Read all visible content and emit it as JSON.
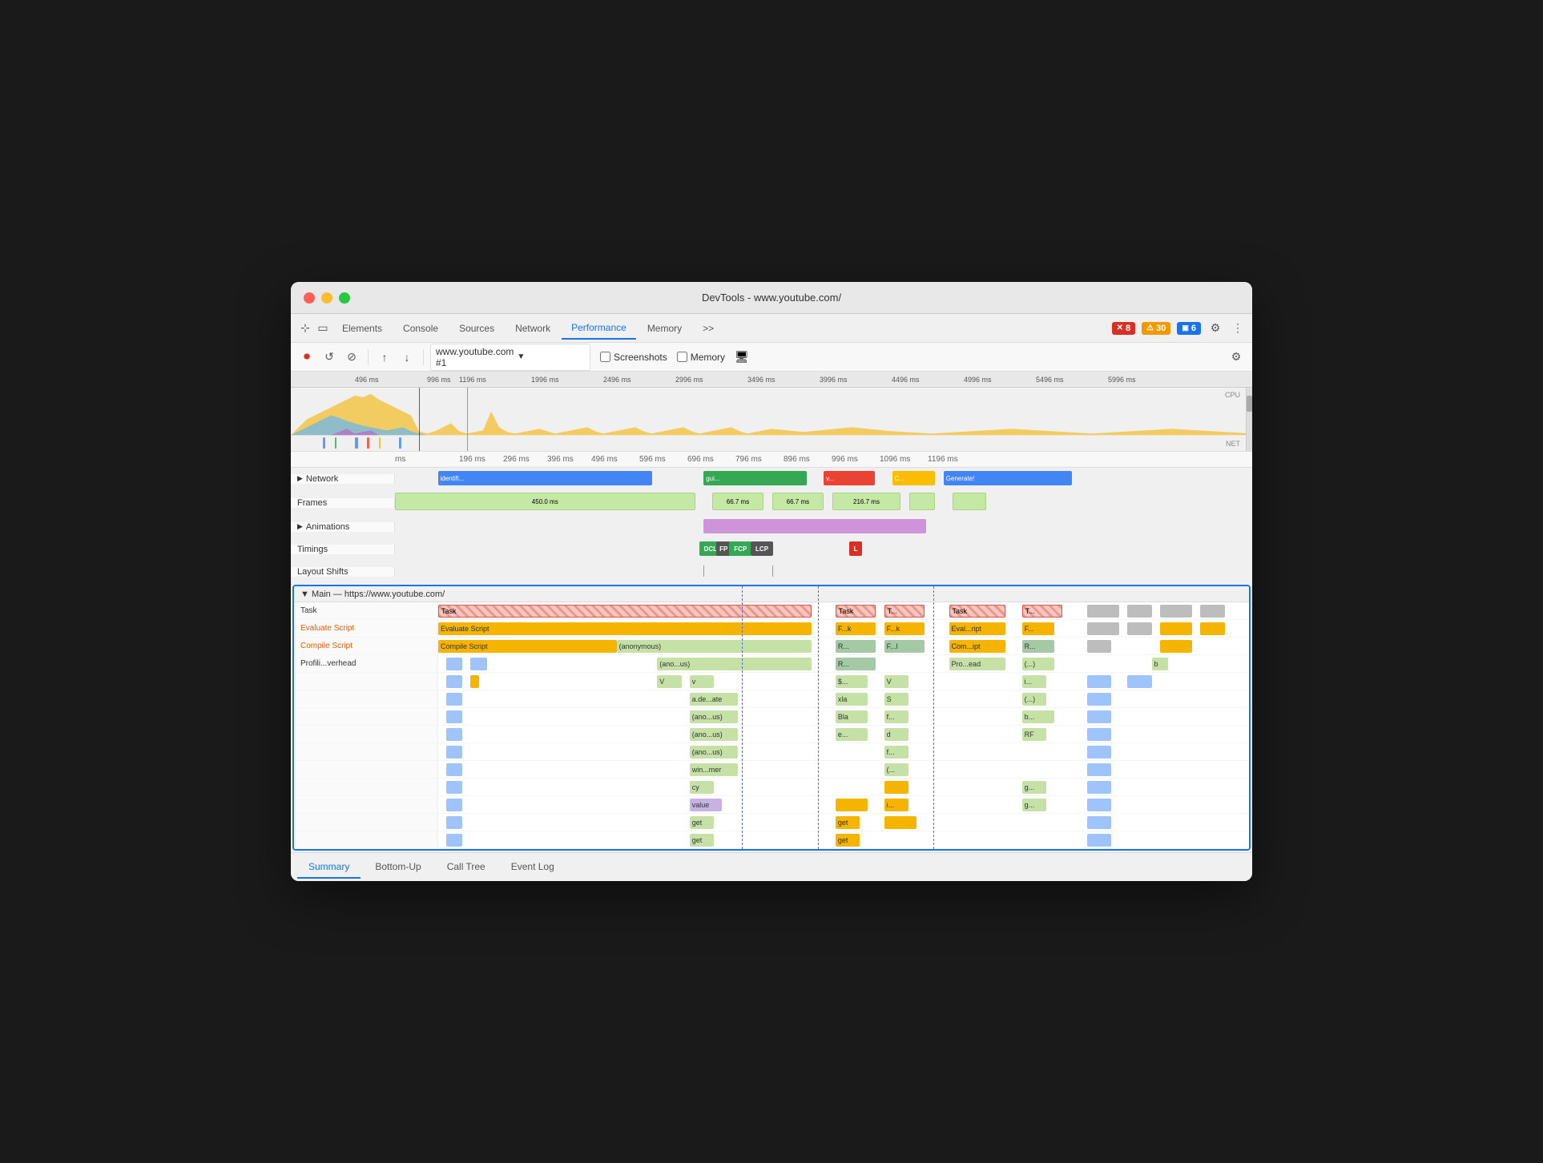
{
  "window": {
    "title": "DevTools - www.youtube.com/"
  },
  "tabs": [
    {
      "label": "Elements",
      "active": false
    },
    {
      "label": "Console",
      "active": false
    },
    {
      "label": "Sources",
      "active": false
    },
    {
      "label": "Network",
      "active": false
    },
    {
      "label": "Performance",
      "active": true
    },
    {
      "label": "Memory",
      "active": false
    }
  ],
  "more_tabs": ">>",
  "errors": {
    "red_count": "8",
    "yellow_count": "30",
    "blue_count": "6"
  },
  "toolbar": {
    "record_label": "Record",
    "reload_label": "Reload",
    "clear_label": "Clear",
    "upload_label": "Upload",
    "download_label": "Download",
    "url_value": "www.youtube.com #1",
    "screenshots_label": "Screenshots",
    "memory_label": "Memory"
  },
  "timeline": {
    "markers": [
      "496 ms",
      "996 ms",
      "1196 ms",
      "1996 ms",
      "2496 ms",
      "2996 ms",
      "3496 ms",
      "3996 ms",
      "4496 ms",
      "4996 ms",
      "5496 ms",
      "5996 ms"
    ],
    "cpu_label": "CPU",
    "net_label": "NET"
  },
  "tracks": {
    "time_markers": [
      "ms",
      "196 ms",
      "296 ms",
      "396 ms",
      "496 ms",
      "596 ms",
      "696 ms",
      "796 ms",
      "896 ms",
      "996 ms",
      "1096 ms",
      "1196 ms"
    ],
    "network_label": "Network",
    "frames_label": "Frames",
    "animations_label": "Animations",
    "timings_label": "Timings",
    "layout_shifts_label": "Layout Shifts"
  },
  "main": {
    "header": "▼  Main — https://www.youtube.com/",
    "rows": [
      {
        "label": "Task",
        "blocks": [
          {
            "text": "Task",
            "color": "#e8998d",
            "left": "0%",
            "width": "48%"
          },
          {
            "text": "Task",
            "color": "#e8998d",
            "left": "51%",
            "width": "5%"
          },
          {
            "text": "T...",
            "color": "#e8998d",
            "left": "57%",
            "width": "7%"
          },
          {
            "text": "Task",
            "color": "#e8998d",
            "left": "66%",
            "width": "8%"
          },
          {
            "text": "T...",
            "color": "#e8998d",
            "left": "77%",
            "width": "5%"
          }
        ]
      },
      {
        "label": "Evaluate Script",
        "blocks": [
          {
            "text": "Evaluate Script",
            "color": "#f4b400",
            "left": "0%",
            "width": "47%"
          },
          {
            "text": "F...k",
            "color": "#f4b400",
            "left": "51%",
            "width": "5%"
          },
          {
            "text": "F...k",
            "color": "#f4b400",
            "left": "57%",
            "width": "7%"
          },
          {
            "text": "Eval...ript",
            "color": "#f4b400",
            "left": "66%",
            "width": "8%"
          },
          {
            "text": "F...",
            "color": "#f4b400",
            "left": "77%",
            "width": "5%"
          }
        ]
      },
      {
        "label": "Compile Script",
        "blocks": [
          {
            "text": "Compile Script",
            "color": "#f4b400",
            "left": "0%",
            "width": "25%"
          },
          {
            "text": "(anonymous)",
            "color": "#c5e1a5",
            "left": "25%",
            "width": "22%"
          },
          {
            "text": "R...",
            "color": "#a8d5a2",
            "left": "51%",
            "width": "5%"
          },
          {
            "text": "F...l",
            "color": "#a8d5a2",
            "left": "57%",
            "width": "7%"
          },
          {
            "text": "Com...ipt",
            "color": "#f4b400",
            "left": "66%",
            "width": "8%"
          },
          {
            "text": "R...",
            "color": "#a8d5a2",
            "left": "77%",
            "width": "5%"
          }
        ]
      },
      {
        "label": "Profili...verhead",
        "blocks": [
          {
            "text": "(ano...us)",
            "color": "#c5e1a5",
            "left": "36%",
            "width": "11%"
          },
          {
            "text": "R...",
            "color": "#a8d5a2",
            "left": "51%",
            "width": "5%"
          },
          {
            "text": "Pro...ead",
            "color": "#c5e1a5",
            "left": "66%",
            "width": "8%"
          },
          {
            "text": "(...)",
            "color": "#c5e1a5",
            "left": "77%",
            "width": "5%"
          },
          {
            "text": "b",
            "color": "#c5e1a5",
            "left": "89%",
            "width": "3%"
          }
        ]
      },
      {
        "label": "",
        "blocks": [
          {
            "text": "V",
            "color": "#c5e1a5",
            "left": "36%",
            "width": "3%"
          },
          {
            "text": "v",
            "color": "#c5e1a5",
            "left": "40%",
            "width": "4%"
          },
          {
            "text": "$...",
            "color": "#c5e1a5",
            "left": "51%",
            "width": "5%"
          },
          {
            "text": "V",
            "color": "#c5e1a5",
            "left": "57%",
            "width": "4%"
          },
          {
            "text": "i...",
            "color": "#c5e1a5",
            "left": "77%",
            "width": "5%"
          }
        ]
      },
      {
        "label": "",
        "blocks": [
          {
            "text": "a.de...ate",
            "color": "#c5e1a5",
            "left": "40%",
            "width": "7%"
          },
          {
            "text": "xla",
            "color": "#c5e1a5",
            "left": "51%",
            "width": "5%"
          },
          {
            "text": "S",
            "color": "#c5e1a5",
            "left": "57%",
            "width": "4%"
          },
          {
            "text": "(...)",
            "color": "#c5e1a5",
            "left": "77%",
            "width": "5%"
          }
        ]
      },
      {
        "label": "",
        "blocks": [
          {
            "text": "(ano...us)",
            "color": "#c5e1a5",
            "left": "40%",
            "width": "7%"
          },
          {
            "text": "Bla",
            "color": "#c5e1a5",
            "left": "51%",
            "width": "5%"
          },
          {
            "text": "f...",
            "color": "#c5e1a5",
            "left": "57%",
            "width": "4%"
          },
          {
            "text": "b...",
            "color": "#c5e1a5",
            "left": "77%",
            "width": "5%"
          }
        ]
      },
      {
        "label": "",
        "blocks": [
          {
            "text": "(ano...us)",
            "color": "#c5e1a5",
            "left": "40%",
            "width": "7%"
          },
          {
            "text": "e...",
            "color": "#c5e1a5",
            "left": "51%",
            "width": "5%"
          },
          {
            "text": "d",
            "color": "#c5e1a5",
            "left": "57%",
            "width": "4%"
          },
          {
            "text": "RF",
            "color": "#c5e1a5",
            "left": "77%",
            "width": "5%"
          }
        ]
      },
      {
        "label": "",
        "blocks": [
          {
            "text": "(ano...us)",
            "color": "#c5e1a5",
            "left": "40%",
            "width": "7%"
          },
          {
            "text": "f...",
            "color": "#c5e1a5",
            "left": "57%",
            "width": "4%"
          }
        ]
      },
      {
        "label": "",
        "blocks": [
          {
            "text": "win...mer",
            "color": "#c5e1a5",
            "left": "40%",
            "width": "7%"
          },
          {
            "text": "(...",
            "color": "#c5e1a5",
            "left": "57%",
            "width": "4%"
          }
        ]
      },
      {
        "label": "",
        "blocks": [
          {
            "text": "cy",
            "color": "#c5e1a5",
            "left": "40%",
            "width": "3%"
          },
          {
            "text": "g...",
            "color": "#c5e1a5",
            "left": "77%",
            "width": "5%"
          }
        ]
      },
      {
        "label": "",
        "blocks": [
          {
            "text": "value",
            "color": "#c5b4e3",
            "left": "40%",
            "width": "5%"
          },
          {
            "text": "i...",
            "color": "#f4b400",
            "left": "57%",
            "width": "4%"
          },
          {
            "text": "g...",
            "color": "#c5e1a5",
            "left": "77%",
            "width": "5%"
          }
        ]
      },
      {
        "label": "",
        "blocks": [
          {
            "text": "get",
            "color": "#c5e1a5",
            "left": "40%",
            "width": "3%"
          },
          {
            "text": "get",
            "color": "#f4b400",
            "left": "51%",
            "width": "3%"
          }
        ]
      },
      {
        "label": "",
        "blocks": [
          {
            "text": "get",
            "color": "#c5e1a5",
            "left": "40%",
            "width": "3%"
          },
          {
            "text": "get",
            "color": "#f4b400",
            "left": "51%",
            "width": "3%"
          }
        ]
      }
    ]
  },
  "bottom_tabs": [
    {
      "label": "Summary",
      "active": true
    },
    {
      "label": "Bottom-Up",
      "active": false
    },
    {
      "label": "Call Tree",
      "active": false
    },
    {
      "label": "Event Log",
      "active": false
    }
  ],
  "timings_badges": [
    {
      "label": "DCL",
      "color": "#1a6b3c",
      "bg": "#34a853"
    },
    {
      "label": "FP",
      "color": "white",
      "bg": "#555"
    },
    {
      "label": "FCP",
      "color": "white",
      "bg": "#34a853"
    },
    {
      "label": "LCP",
      "color": "white",
      "bg": "#555"
    },
    {
      "label": "L",
      "color": "white",
      "bg": "#d93025"
    }
  ]
}
